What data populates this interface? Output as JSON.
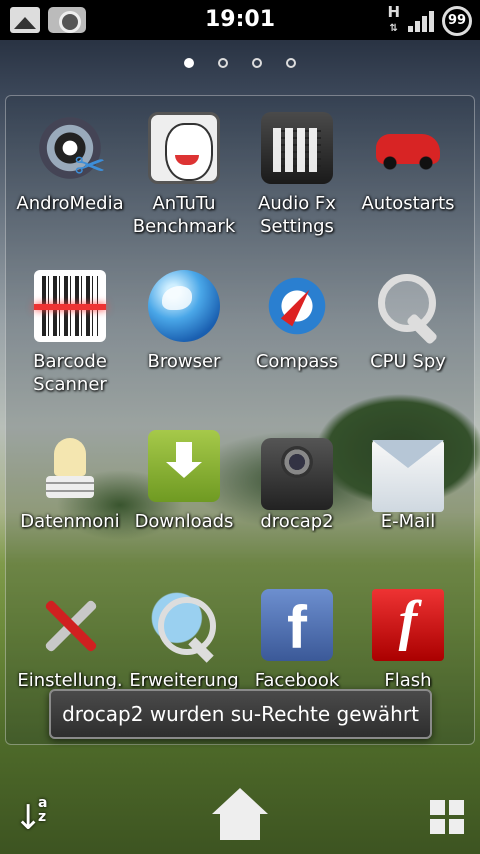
{
  "status_bar": {
    "time": "19:01",
    "network_type": "H",
    "battery_level": "99",
    "icons": [
      "picture-icon",
      "camera-icon",
      "network-h-icon",
      "signal-icon",
      "battery-icon"
    ]
  },
  "home_pages": {
    "count": 4,
    "active_index": 0
  },
  "app_drawer": {
    "apps": [
      {
        "label": "AndroMedia",
        "icon": "andromedia-icon"
      },
      {
        "label": "AnTuTu\nBenchmark",
        "icon": "antutu-icon"
      },
      {
        "label": "Audio Fx\nSettings",
        "icon": "audio-fx-icon"
      },
      {
        "label": "Autostarts",
        "icon": "autostarts-icon"
      },
      {
        "label": "Barcode\nScanner",
        "icon": "barcode-icon"
      },
      {
        "label": "Browser",
        "icon": "browser-icon"
      },
      {
        "label": "Compass",
        "icon": "compass-icon"
      },
      {
        "label": "CPU Spy",
        "icon": "cpu-spy-icon"
      },
      {
        "label": "Datenmoni",
        "icon": "datenmonitor-icon"
      },
      {
        "label": "Downloads",
        "icon": "downloads-icon"
      },
      {
        "label": "drocap2",
        "icon": "drocap-icon"
      },
      {
        "label": "E-Mail",
        "icon": "email-icon"
      },
      {
        "label": "Einstellung.",
        "icon": "settings-icon"
      },
      {
        "label": "Erweiterung",
        "icon": "extension-icon"
      },
      {
        "label": "Facebook",
        "icon": "facebook-icon"
      },
      {
        "label": "Flash",
        "icon": "flash-icon"
      }
    ]
  },
  "toast": {
    "message": "drocap2 wurden su-Rechte gewährt"
  },
  "bottom_bar": {
    "sort_az_label": "a\nz",
    "icons": [
      "sort-icon",
      "home-icon",
      "grid-icon"
    ]
  }
}
